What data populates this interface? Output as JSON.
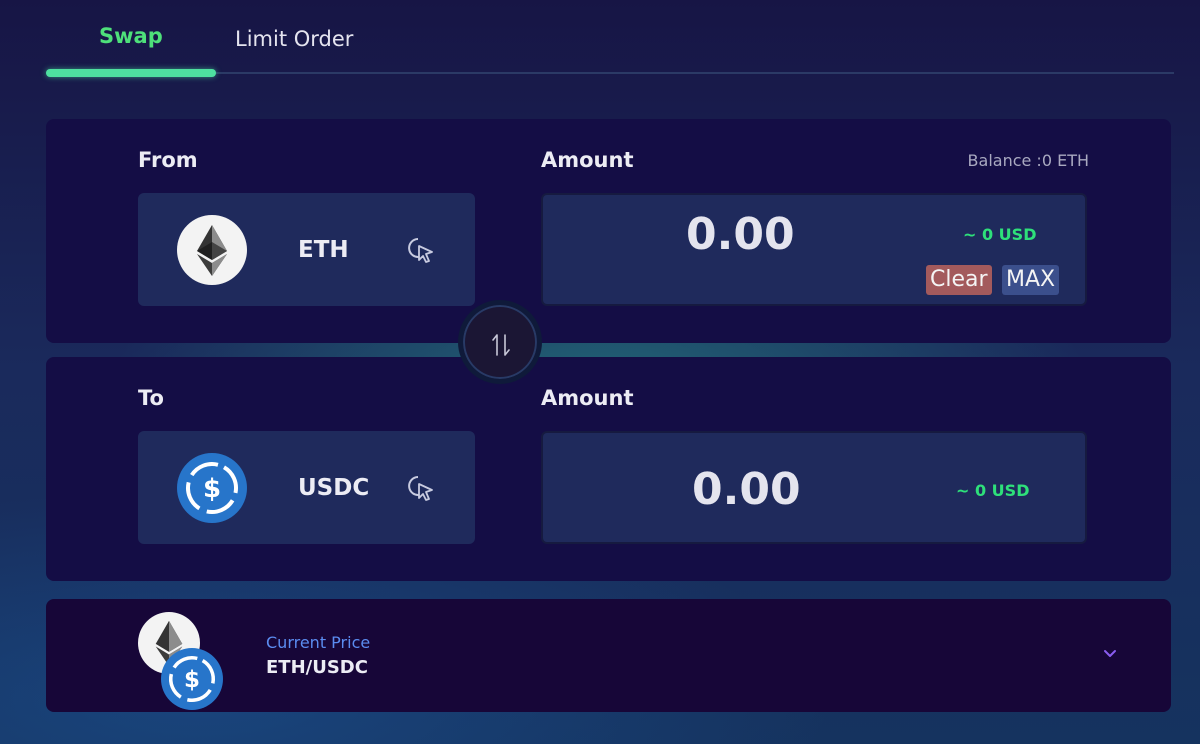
{
  "tabs": {
    "swap": "Swap",
    "limit_order": "Limit Order"
  },
  "from": {
    "label": "From",
    "amount_label": "Amount",
    "balance": "Balance :0 ETH",
    "token": "ETH",
    "amount": "0.00",
    "usd": "~ 0 USD",
    "clear_label": "Clear",
    "max_label": "MAX"
  },
  "to": {
    "label": "To",
    "amount_label": "Amount",
    "token": "USDC",
    "amount": "0.00",
    "usd": "~ 0 USD"
  },
  "price": {
    "label": "Current Price",
    "pair": "ETH/USDC"
  },
  "icons": [
    "ethereum-logo-icon",
    "usdc-logo-icon",
    "pointer-click-icon",
    "swap-arrows-icon",
    "chevron-down-icon"
  ],
  "colors": {
    "accent_green": "#4ee07a",
    "usd_green": "#2ee07a",
    "clear_red": "#a35a5c",
    "max_blue": "#3b4f8c",
    "usdc_blue": "#2775ca"
  }
}
